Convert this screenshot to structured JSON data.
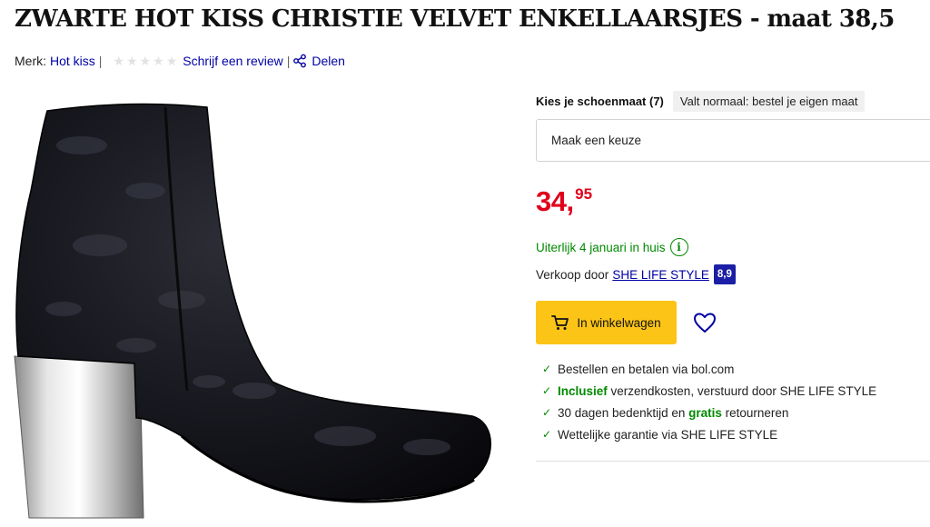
{
  "product": {
    "title": "ZWARTE HOT KISS CHRISTIE VELVET ENKELLAARSJES - maat 38,5"
  },
  "meta": {
    "brand_label": "Merk:",
    "brand": "Hot kiss",
    "separator": "|",
    "stars": 5,
    "review_link": "Schrijf een review",
    "share_label": "Delen"
  },
  "size": {
    "label": "Kies je schoenmaat (7)",
    "fit_note": "Valt normaal: bestel je eigen maat",
    "select_placeholder": "Maak een keuze"
  },
  "price": {
    "whole": "34",
    "comma": ",",
    "cents": "95",
    "color": "#e0001b"
  },
  "delivery": {
    "text": "Uiterlijk 4 januari in huis",
    "icon": "info-icon"
  },
  "seller": {
    "prefix": "Verkoop door",
    "name": "SHE LIFE STYLE",
    "rating": "8,9"
  },
  "actions": {
    "cart_label": "In winkelwagen",
    "cart_icon": "cart-icon",
    "wish_icon": "heart-icon",
    "cart_color": "#fcc417"
  },
  "usps": [
    {
      "pre": "",
      "bold": "",
      "post": "Bestellen en betalen via bol.com"
    },
    {
      "pre": "",
      "bold": "Inclusief",
      "post": " verzendkosten, verstuurd door SHE LIFE STYLE"
    },
    {
      "pre": "30 dagen bedenktijd en ",
      "bold": "gratis",
      "post": " retourneren"
    },
    {
      "pre": "",
      "bold": "",
      "post": "Wettelijke garantie via SHE LIFE STYLE"
    }
  ]
}
